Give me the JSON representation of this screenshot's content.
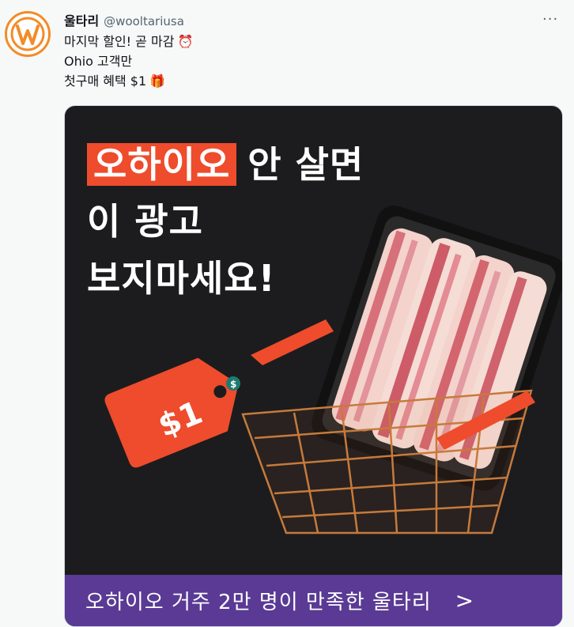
{
  "tweet": {
    "display_name": "울타리",
    "handle": "@wooltariusa",
    "more_icon": "more-options-icon",
    "lines": [
      {
        "text": "마지막 할인! 곧 마감",
        "emoji": "⏰"
      },
      {
        "text": "Ohio 고객만",
        "emoji": ""
      },
      {
        "text": "첫구매 혜택 $1",
        "emoji": "🎁"
      }
    ]
  },
  "ad": {
    "headline_accent": "오하이오",
    "headline_rest": "안 살면",
    "headline_line2": "이 광고",
    "headline_line3": "보지마세요!",
    "price_tag": "$1",
    "price_tag_symbol": "$",
    "cta_text": "오하이오 거주 2만 명이 만족한 울타리",
    "cta_arrow": ">",
    "colors": {
      "accent": "#ee4c2c",
      "background": "#1c1c1e",
      "cta": "#5a3a94"
    }
  },
  "brand": {
    "avatar_letter": "W",
    "color": "#f28c28"
  }
}
